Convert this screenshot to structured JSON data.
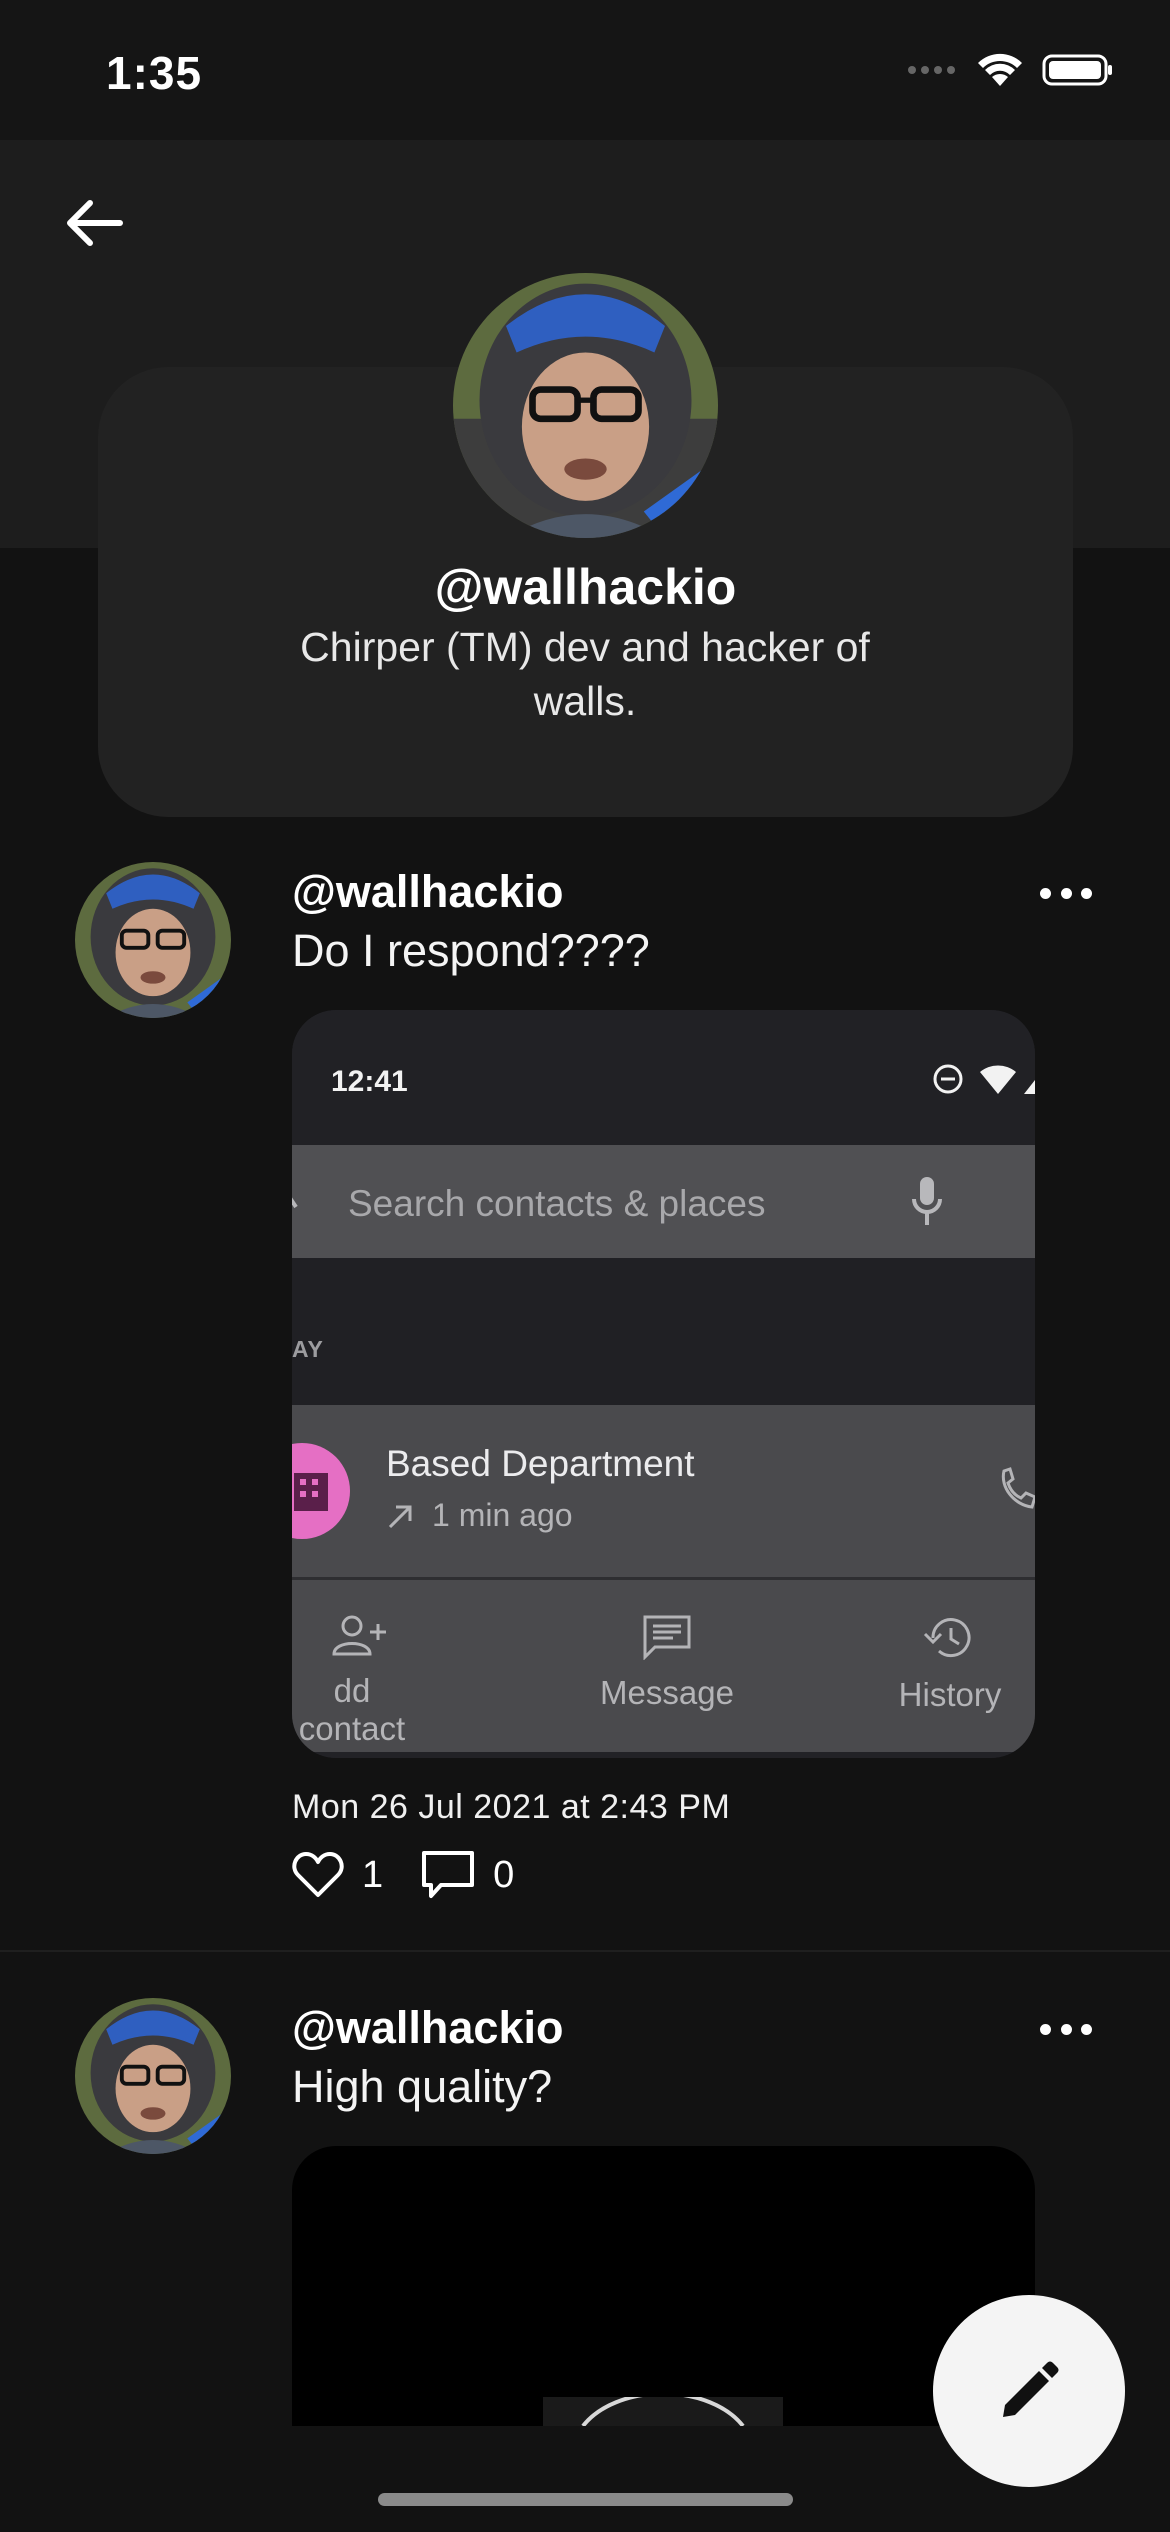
{
  "status_bar": {
    "time": "1:35"
  },
  "profile": {
    "handle": "@wallhackio",
    "bio": "Chirper (TM) dev and hacker of walls."
  },
  "posts": [
    {
      "handle": "@wallhackio",
      "text": "Do I respond????",
      "timestamp": "Mon 26 Jul 2021 at 2:43 PM",
      "likes": "1",
      "comments": "0",
      "embedded_screenshot": {
        "time": "12:41",
        "search_placeholder": "Search contacts & places",
        "section_label": "AY",
        "contact_name": "Based Department",
        "contact_time": "1 min ago",
        "actions": [
          "dd contact",
          "Message",
          "History"
        ]
      }
    },
    {
      "handle": "@wallhackio",
      "text": "High quality?"
    }
  ],
  "icons": {
    "back": "arrow-left-icon",
    "more": "more-horizontal-icon",
    "like": "heart-icon",
    "comment": "comment-icon",
    "compose": "pencil-icon"
  },
  "colors": {
    "background": "#121212",
    "card": "#222222",
    "fab": "#f4f4f4",
    "contact_icon": "#e56fc4"
  }
}
